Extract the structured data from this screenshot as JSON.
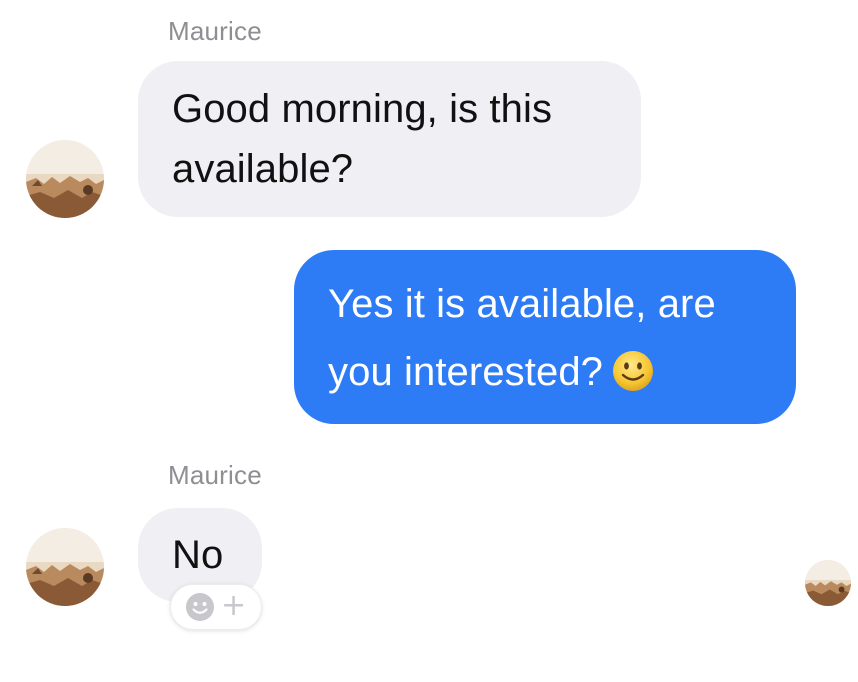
{
  "conversation": {
    "messages": [
      {
        "sender": "Maurice",
        "direction": "incoming",
        "lines": [
          "Good morning, is this",
          "available?"
        ]
      },
      {
        "direction": "outgoing",
        "lines": [
          "Yes it is available, are",
          "you interested?"
        ],
        "emoji": "slightly-smiling-face-icon"
      },
      {
        "sender": "Maurice",
        "direction": "incoming",
        "lines": [
          "No"
        ]
      }
    ],
    "reaction_plus": "+"
  },
  "colors": {
    "incoming_bubble": "#efeff4",
    "outgoing_bubble": "#2d7cf6",
    "sender_name": "#8e8e93"
  }
}
